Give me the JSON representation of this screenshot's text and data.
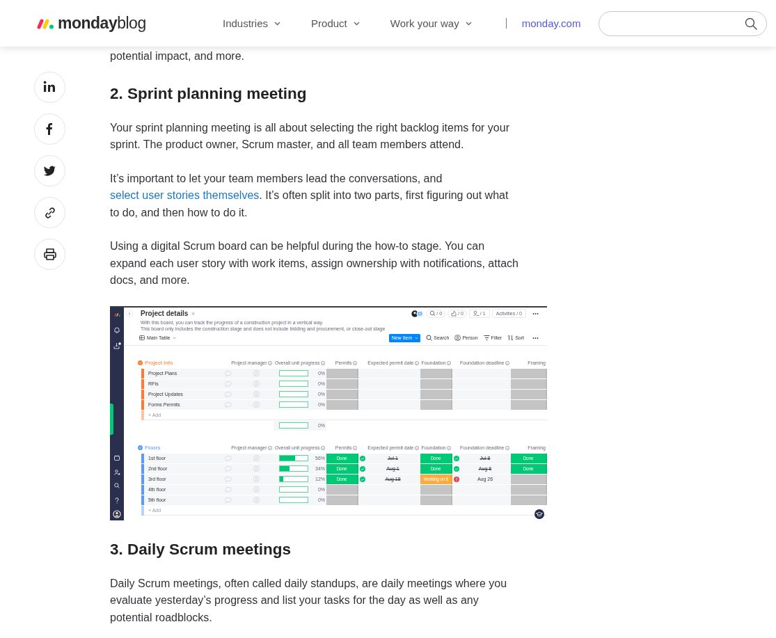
{
  "header": {
    "logo": {
      "brand": "monday",
      "suffix": "blog"
    },
    "nav": [
      {
        "label": "Industries",
        "kind": "menu"
      },
      {
        "label": "Product",
        "kind": "menu"
      },
      {
        "label": "Work your way",
        "kind": "menu"
      },
      {
        "label": "monday.com",
        "kind": "link"
      }
    ]
  },
  "share": [
    {
      "kind": "linkedin"
    },
    {
      "kind": "facebook"
    },
    {
      "kind": "twitter"
    },
    {
      "kind": "link"
    },
    {
      "kind": "print"
    }
  ],
  "article": [
    {
      "kind": "paragraph",
      "parts": [
        {
          "text": "potential impact, and more."
        }
      ]
    },
    {
      "kind": "heading",
      "text": "2. Sprint planning meeting"
    },
    {
      "kind": "paragraph",
      "parts": [
        {
          "text": "Your sprint planning meeting is all about selecting the right backlog items for your sprint. The product owner, Scrum master, and all team members attend."
        }
      ]
    },
    {
      "kind": "paragraph",
      "parts": [
        {
          "text": "It’s important to let your team members lead the conversations, and "
        },
        {
          "text": "select user stories themselves",
          "link": true
        },
        {
          "text": ". It’s often split into two parts, first figuring out what to do, and then how to do it."
        }
      ]
    },
    {
      "kind": "paragraph",
      "parts": [
        {
          "text": "Using a digital Scrum board can be helpful during the how-to stage. You can expand each user story with work items, assign ownership with notifications, attach docs, and more."
        }
      ]
    },
    {
      "kind": "screenshot",
      "title": "Project details",
      "description": [
        "With this board, you can track the progress of a construction project in a vertical way.",
        "This board only includes the construction stage and does not include bidding and procurement, or close-out stage"
      ],
      "header_buttons": [
        {
          "kind": "search",
          "label": "/ 0"
        },
        {
          "kind": "updates",
          "label": "/ 0"
        },
        {
          "kind": "members",
          "label": "/ 1"
        },
        {
          "kind": "text",
          "label": "Activities / 0"
        }
      ],
      "view": "Main Table",
      "new_item": "New Item",
      "tools": [
        {
          "kind": "search",
          "label": "Search"
        },
        {
          "kind": "person",
          "label": "Person"
        },
        {
          "kind": "filter",
          "label": "Filter"
        },
        {
          "kind": "sort",
          "label": "Sort"
        }
      ],
      "groups": [
        {
          "name": "Project Info",
          "color": "#ff7a2e",
          "columns": [
            "Project manager",
            "Overall unit progress",
            "Permits",
            "Expected permit date",
            "Foundation",
            "Foundation deadline",
            "Framing"
          ],
          "rows": [
            {
              "name": "Project Plans",
              "cells": [
                {
                  "kind": "person"
                },
                {
                  "kind": "progress",
                  "level": 0,
                  "text": "0%"
                },
                {
                  "kind": "status",
                  "color": "#c4c4c4"
                },
                {
                  "kind": "date"
                },
                {
                  "kind": "status",
                  "color": "#c4c4c4"
                },
                {
                  "kind": "date"
                },
                {
                  "kind": "status",
                  "color": "#c4c4c4"
                }
              ]
            },
            {
              "name": "RFIs",
              "cells": [
                {
                  "kind": "person"
                },
                {
                  "kind": "progress",
                  "level": 0,
                  "text": "0%"
                },
                {
                  "kind": "status",
                  "color": "#c4c4c4"
                },
                {
                  "kind": "date"
                },
                {
                  "kind": "status",
                  "color": "#c4c4c4"
                },
                {
                  "kind": "date"
                },
                {
                  "kind": "status",
                  "color": "#c4c4c4"
                }
              ]
            },
            {
              "name": "Project Updates",
              "cells": [
                {
                  "kind": "person"
                },
                {
                  "kind": "progress",
                  "level": 0,
                  "text": "0%"
                },
                {
                  "kind": "status",
                  "color": "#c4c4c4"
                },
                {
                  "kind": "date"
                },
                {
                  "kind": "status",
                  "color": "#c4c4c4"
                },
                {
                  "kind": "date"
                },
                {
                  "kind": "status",
                  "color": "#c4c4c4"
                }
              ]
            },
            {
              "name": "Forms Permits",
              "cells": [
                {
                  "kind": "person"
                },
                {
                  "kind": "progress",
                  "level": 0,
                  "text": "0%"
                },
                {
                  "kind": "status",
                  "color": "#c4c4c4"
                },
                {
                  "kind": "date"
                },
                {
                  "kind": "status",
                  "color": "#c4c4c4"
                },
                {
                  "kind": "date"
                },
                {
                  "kind": "status",
                  "color": "#c4c4c4"
                }
              ]
            }
          ],
          "add": "+ Add",
          "summary": {
            "level": 0,
            "text": "0%"
          }
        },
        {
          "name": "Floors",
          "color": "#579bfc",
          "columns": [
            "Project manager",
            "Overall unit progress",
            "Permits",
            "Expected permit date",
            "Foundation",
            "Foundation deadline",
            "Framing"
          ],
          "rows": [
            {
              "name": "1st floor",
              "cells": [
                {
                  "kind": "person"
                },
                {
                  "kind": "progress",
                  "level": 0.56,
                  "text": "56%"
                },
                {
                  "kind": "status",
                  "label": "Done",
                  "color": "#00c875"
                },
                {
                  "kind": "date",
                  "text": "Jul 1",
                  "struck": true,
                  "overdue": false
                },
                {
                  "kind": "status",
                  "label": "Done",
                  "color": "#00c875"
                },
                {
                  "kind": "date",
                  "text": "Jul 8",
                  "struck": true,
                  "overdue": false
                },
                {
                  "kind": "status",
                  "label": "Done",
                  "color": "#00c875"
                }
              ]
            },
            {
              "name": "2nd floor",
              "cells": [
                {
                  "kind": "person"
                },
                {
                  "kind": "progress",
                  "level": 0.34,
                  "text": "34%"
                },
                {
                  "kind": "status",
                  "label": "Done",
                  "color": "#00c875"
                },
                {
                  "kind": "date",
                  "text": "Aug 1",
                  "struck": true,
                  "overdue": false
                },
                {
                  "kind": "status",
                  "label": "Done",
                  "color": "#00c875"
                },
                {
                  "kind": "date",
                  "text": "Aug 8",
                  "struck": true,
                  "overdue": false
                },
                {
                  "kind": "status",
                  "label": "Done",
                  "color": "#00c875"
                }
              ]
            },
            {
              "name": "3rd floor",
              "cells": [
                {
                  "kind": "person"
                },
                {
                  "kind": "progress",
                  "level": 0.12,
                  "text": "12%"
                },
                {
                  "kind": "status",
                  "label": "Done",
                  "color": "#00c875"
                },
                {
                  "kind": "date",
                  "text": "Aug 18",
                  "struck": true,
                  "overdue": false
                },
                {
                  "kind": "status",
                  "label": "Working on it",
                  "color": "#fdab3d"
                },
                {
                  "kind": "date",
                  "text": "Aug 26",
                  "struck": false,
                  "overdue": true
                },
                {
                  "kind": "status",
                  "color": "#c4c4c4"
                }
              ]
            },
            {
              "name": "4th floor",
              "cells": [
                {
                  "kind": "person"
                },
                {
                  "kind": "progress",
                  "level": 0,
                  "text": "0%"
                },
                {
                  "kind": "status",
                  "color": "#c4c4c4"
                },
                {
                  "kind": "date"
                },
                {
                  "kind": "status",
                  "color": "#c4c4c4"
                },
                {
                  "kind": "date"
                },
                {
                  "kind": "status",
                  "color": "#c4c4c4"
                }
              ]
            },
            {
              "name": "5th floor",
              "cells": [
                {
                  "kind": "person"
                },
                {
                  "kind": "progress",
                  "level": 0,
                  "text": "0%"
                },
                {
                  "kind": "status",
                  "color": "#c4c4c4"
                },
                {
                  "kind": "date"
                },
                {
                  "kind": "status",
                  "color": "#c4c4c4"
                },
                {
                  "kind": "date"
                },
                {
                  "kind": "status",
                  "color": "#c4c4c4"
                }
              ]
            }
          ],
          "add": "+ Add"
        }
      ]
    },
    {
      "kind": "heading",
      "text": "3. Daily Scrum meetings"
    },
    {
      "kind": "paragraph",
      "parts": [
        {
          "text": "Daily Scrum meetings, often called daily standups, are daily meetings where you evaluate yesterday’s progress and list your tasks for the day as well as any potential roadblocks."
        }
      ]
    }
  ]
}
